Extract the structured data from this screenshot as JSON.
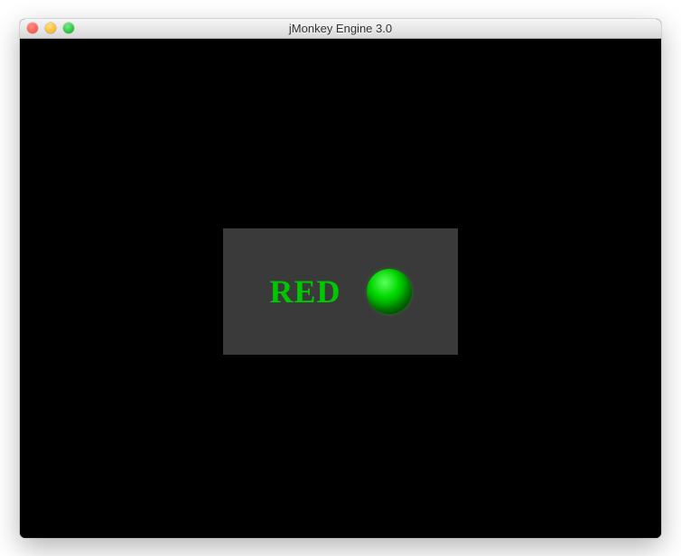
{
  "window": {
    "title": "jMonkey Engine 3.0"
  },
  "panel": {
    "text": "RED",
    "text_color": "#00c800",
    "background": "#3a3a3a",
    "sphere_color": "#00d800"
  },
  "icons": {
    "close": "close",
    "minimize": "minimize",
    "maximize": "maximize"
  }
}
